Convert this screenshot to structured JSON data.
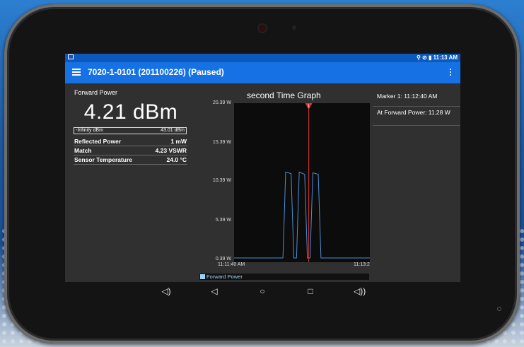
{
  "status_bar": {
    "time": "11:13 AM",
    "icons": [
      "location-icon",
      "signal-off-icon",
      "battery-icon"
    ]
  },
  "app_bar": {
    "title": "7020-1-0101 (201100226) (Paused)"
  },
  "forward_power": {
    "label": "Forward Power",
    "value": "4.21 dBm",
    "range_min": "-Infinity dBm",
    "range_max": "43.01 dBm"
  },
  "measurements": [
    {
      "label": "Reflected Power",
      "value": "1 mW"
    },
    {
      "label": "Match",
      "value": "4.23 VSWR"
    },
    {
      "label": "Sensor Temperature",
      "value": "24.0 °C"
    }
  ],
  "chart_data": {
    "type": "line",
    "title": "second Time Graph",
    "ylabel": "",
    "xlabel": "",
    "y_ticks": [
      "20.39 W",
      "15.39 W",
      "10.39 W",
      "5.39 W",
      "0.39 W"
    ],
    "ylim": [
      0.39,
      20.39
    ],
    "x_ticks": [
      "11:11:40 AM",
      "11:13:2"
    ],
    "series": [
      {
        "name": "Forward Power",
        "color": "#4a8fd6",
        "x": [
          0.0,
          0.36,
          0.38,
          0.42,
          0.44,
          0.46,
          0.48,
          0.52,
          0.54,
          0.56,
          0.58,
          0.62,
          0.64,
          0.66,
          0.68,
          1.0
        ],
        "values": [
          0.39,
          0.39,
          11.8,
          11.6,
          0.39,
          0.39,
          11.8,
          11.5,
          0.39,
          0.39,
          11.7,
          11.5,
          0.39,
          0.39,
          0.39,
          0.39
        ]
      }
    ],
    "marker": {
      "label": "1",
      "x": 0.55,
      "color": "#e53030"
    },
    "legend": {
      "position": "bottom"
    }
  },
  "markers_panel": {
    "marker1": "Marker 1: 11:12:40 AM",
    "at_value": "At Forward Power: 11.28 W"
  },
  "nav": {
    "icons": [
      "volume-down-icon",
      "back-icon",
      "home-icon",
      "recents-icon",
      "volume-up-icon"
    ]
  }
}
